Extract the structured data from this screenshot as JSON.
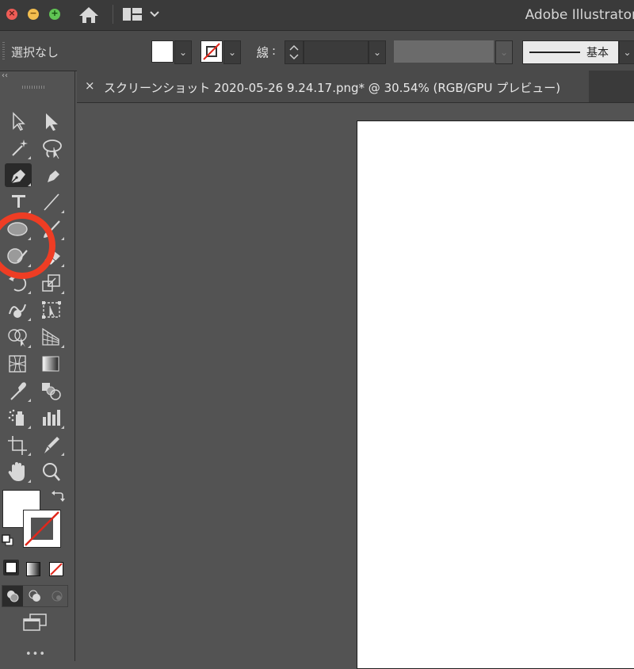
{
  "window": {
    "app_title": "Adobe Illustrator"
  },
  "control_bar": {
    "selection_status": "選択なし",
    "stroke_label": "線",
    "brush_definition": "基本"
  },
  "document": {
    "tab_close": "×",
    "tab_title": "スクリーンショット 2020-05-26 9.24.17.png* @ 30.54% (RGB/GPU プレビュー)"
  },
  "toolbar": {
    "collapse": "‹‹",
    "tools": [
      "selection-tool",
      "direct-selection-tool",
      "magic-wand-tool",
      "lasso-tool",
      "pen-tool",
      "curvature-tool",
      "type-tool",
      "line-segment-tool",
      "ellipse-tool",
      "paintbrush-tool",
      "shaper-tool",
      "eraser-tool",
      "rotate-tool",
      "scale-tool",
      "warp-tool",
      "free-transform-tool",
      "shape-builder-tool",
      "perspective-grid-tool",
      "mesh-tool",
      "gradient-tool",
      "eyedropper-tool",
      "blend-tool",
      "symbol-sprayer-tool",
      "column-graph-tool",
      "artboard-tool",
      "slice-tool",
      "hand-tool",
      "zoom-tool"
    ],
    "selected_tool": "pen-tool",
    "more": "•••"
  },
  "colors": {
    "fill": "#ffffff",
    "stroke": "none",
    "highlight": "#ee3d24"
  }
}
